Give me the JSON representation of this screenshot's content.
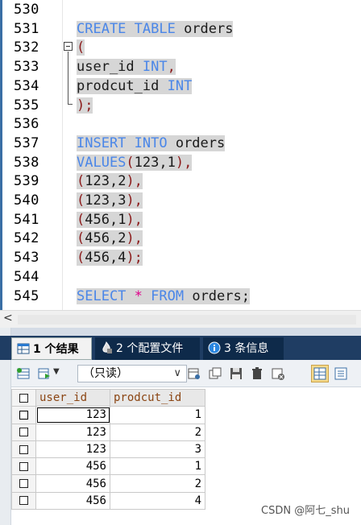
{
  "editor": {
    "line_numbers": [
      "530",
      "531",
      "532",
      "533",
      "534",
      "535",
      "536",
      "537",
      "538",
      "539",
      "540",
      "541",
      "542",
      "543",
      "544",
      "545"
    ],
    "lines": [
      {
        "tokens": []
      },
      {
        "tokens": [
          {
            "t": "CREATE TABLE",
            "c": "kw"
          },
          {
            "t": " orders",
            "c": "id"
          }
        ]
      },
      {
        "tokens": [
          {
            "t": "(",
            "c": "paren"
          }
        ]
      },
      {
        "tokens": [
          {
            "t": "user_id",
            "c": "id"
          },
          {
            "t": " INT",
            "c": "kw"
          },
          {
            "t": ",",
            "c": "punc"
          }
        ]
      },
      {
        "tokens": [
          {
            "t": "prodcut_id",
            "c": "id"
          },
          {
            "t": " INT",
            "c": "kw"
          }
        ]
      },
      {
        "tokens": [
          {
            "t": ");",
            "c": "paren"
          }
        ]
      },
      {
        "tokens": []
      },
      {
        "tokens": [
          {
            "t": "INSERT INTO",
            "c": "kw"
          },
          {
            "t": " orders",
            "c": "id"
          }
        ]
      },
      {
        "tokens": [
          {
            "t": "VALUES",
            "c": "kw"
          },
          {
            "t": "(",
            "c": "paren"
          },
          {
            "t": "123,1",
            "c": "num"
          },
          {
            "t": "),",
            "c": "paren"
          }
        ]
      },
      {
        "tokens": [
          {
            "t": "(",
            "c": "paren"
          },
          {
            "t": "123,2",
            "c": "num"
          },
          {
            "t": "),",
            "c": "paren"
          }
        ]
      },
      {
        "tokens": [
          {
            "t": "(",
            "c": "paren"
          },
          {
            "t": "123,3",
            "c": "num"
          },
          {
            "t": "),",
            "c": "paren"
          }
        ]
      },
      {
        "tokens": [
          {
            "t": "(",
            "c": "paren"
          },
          {
            "t": "456,1",
            "c": "num"
          },
          {
            "t": "),",
            "c": "paren"
          }
        ]
      },
      {
        "tokens": [
          {
            "t": "(",
            "c": "paren"
          },
          {
            "t": "456,2",
            "c": "num"
          },
          {
            "t": "),",
            "c": "paren"
          }
        ]
      },
      {
        "tokens": [
          {
            "t": "(",
            "c": "paren"
          },
          {
            "t": "456,4",
            "c": "num"
          },
          {
            "t": ");",
            "c": "paren"
          }
        ]
      },
      {
        "tokens": []
      },
      {
        "tokens": [
          {
            "t": "SELECT",
            "c": "kw"
          },
          {
            "t": " * ",
            "c": "star"
          },
          {
            "t": "FROM",
            "c": "kw"
          },
          {
            "t": " orders;",
            "c": "id"
          }
        ]
      }
    ]
  },
  "scroll": {
    "left_arrow": "<"
  },
  "tabs": {
    "result_label": "1 个结果",
    "profile_label": "2 个配置文件",
    "info_label": "3 条信息"
  },
  "toolbar": {
    "mode_value": "（只读）",
    "caret": "∨"
  },
  "grid": {
    "columns": [
      "user_id",
      "prodcut_id"
    ],
    "rows": [
      [
        "123",
        "1"
      ],
      [
        "123",
        "2"
      ],
      [
        "123",
        "3"
      ],
      [
        "456",
        "1"
      ],
      [
        "456",
        "2"
      ],
      [
        "456",
        "4"
      ]
    ]
  },
  "watermark": "CSDN @阿七_shu",
  "colors": {
    "keyword": "#4a86e8",
    "selection": "#d6d6d6",
    "tab_bar": "#1f3d63"
  }
}
